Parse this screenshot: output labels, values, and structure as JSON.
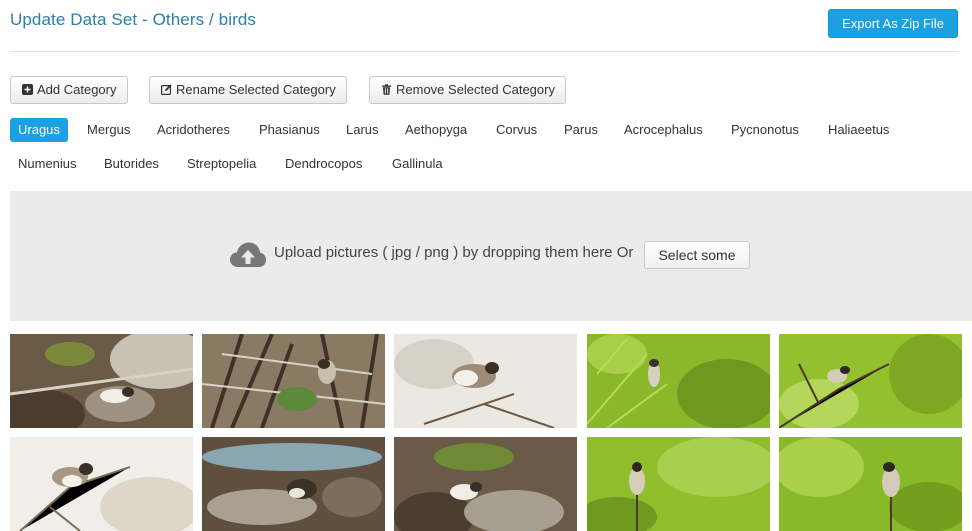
{
  "header": {
    "title": "Update Data Set - Others / birds",
    "export_label": "Export As Zip File"
  },
  "toolbar": {
    "add_label": "Add Category",
    "rename_label": "Rename Selected Category",
    "remove_label": "Remove Selected Category"
  },
  "categories": {
    "active": "Uragus",
    "items": [
      "Uragus",
      "Mergus",
      "Acridotheres",
      "Phasianus",
      "Larus",
      "Aethopyga",
      "Corvus",
      "Parus",
      "Acrocephalus",
      "Pycnonotus",
      "Haliaeetus",
      "Numenius",
      "Butorides",
      "Streptopelia",
      "Dendrocopos",
      "Gallinula"
    ]
  },
  "upload": {
    "text": "Upload pictures ( jpg / png ) by dropping them here Or",
    "select_label": "Select some",
    "icon": "cloud-upload-icon"
  },
  "gallery": {
    "images": [
      {
        "name": "bird-photo",
        "palette": "sepia"
      },
      {
        "name": "bird-photo",
        "palette": "sepia"
      },
      {
        "name": "bird-photo",
        "palette": "light"
      },
      {
        "name": "bird-photo",
        "palette": "green"
      },
      {
        "name": "bird-photo",
        "palette": "green"
      },
      {
        "name": "bird-photo",
        "palette": "light"
      },
      {
        "name": "bird-photo",
        "palette": "sepia"
      },
      {
        "name": "bird-photo",
        "palette": "sepia"
      },
      {
        "name": "bird-photo",
        "palette": "green"
      },
      {
        "name": "bird-photo",
        "palette": "green"
      }
    ]
  },
  "colors": {
    "accent": "#1ba1e2",
    "title": "#2a7fab",
    "dropzone": "#ebebeb"
  }
}
